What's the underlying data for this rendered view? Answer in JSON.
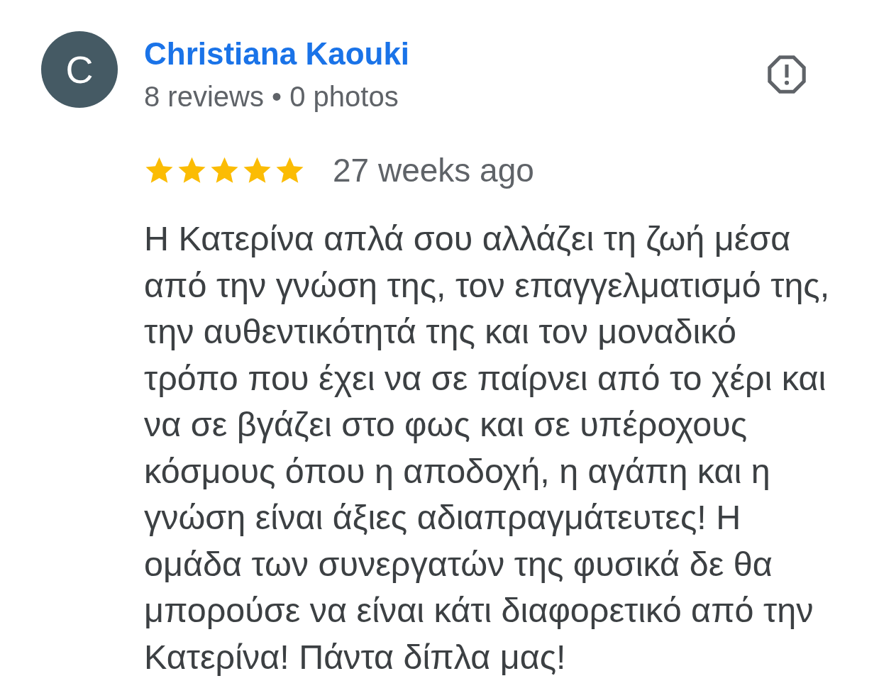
{
  "reviewer": {
    "initial": "C",
    "name": "Christiana Kaouki",
    "meta": "8 reviews • 0 photos"
  },
  "review": {
    "stars": 5,
    "time": "27 weeks ago",
    "text": "Η Κατερίνα απλά σου αλλάζει τη ζωή μέσα από την γνώση της, τον επαγγελματισμό της, την αυθεντικότητά της και τον μοναδικό τρόπο που έχει να σε παίρνει από το χέρι και να σε βγάζει στο φως και σε υπέροχους κόσμους όπου η αποδοχή, η αγάπη και η γνώση είναι άξιες αδιαπραγμάτευτες! Η ομάδα των συνεργατών της φυσικά δε θα μπορούσε να είναι κάτι διαφορετικό από την Κατερίνα! Πάντα δίπλα μας!"
  }
}
